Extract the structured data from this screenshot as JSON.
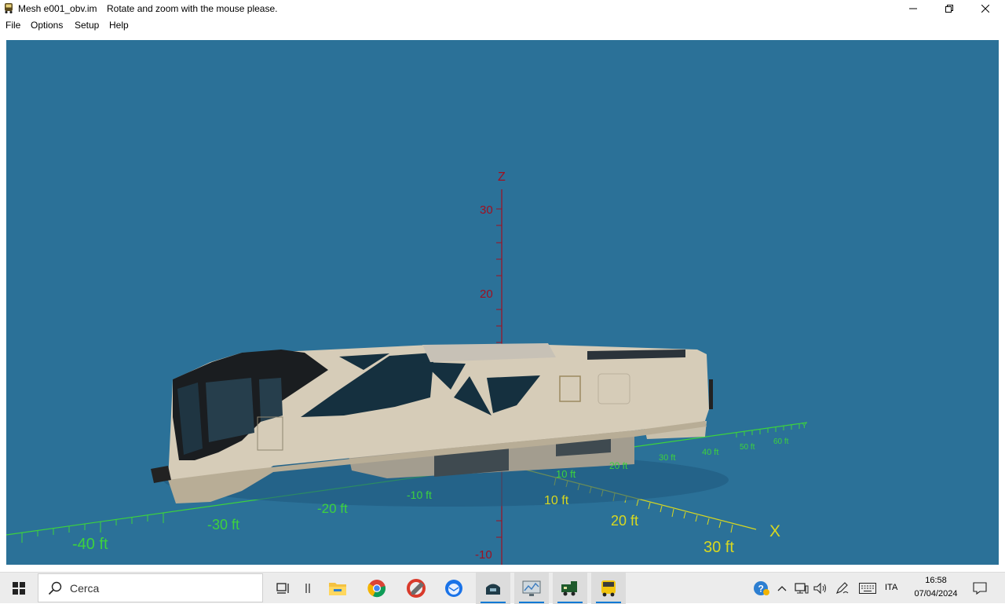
{
  "window": {
    "title": "Mesh e001_obv.im",
    "hint": "Rotate and zoom with the mouse please."
  },
  "menu": {
    "items": [
      "File",
      "Options",
      "Setup",
      "Help"
    ]
  },
  "viewport": {
    "background": "#2b7198",
    "z_axis": {
      "label": "Z",
      "color": "#a01020",
      "ticks": [
        "30",
        "20",
        "-10"
      ]
    },
    "x_axis": {
      "label": "X",
      "color": "#d8d820",
      "ticks": [
        "10 ft",
        "20 ft",
        "30 ft"
      ]
    },
    "y_axis": {
      "label": "Y",
      "color": "#3dd23d",
      "ticks_negative": [
        "-10 ft",
        "-20 ft",
        "-30 ft",
        "-40 ft"
      ],
      "ticks_positive": [
        "10 ft",
        "20 ft",
        "30 ft",
        "40 ft",
        "50 ft",
        "60 ft"
      ]
    },
    "model": {
      "name": "train car",
      "body_color": "#d6ccb8",
      "window_color": "#15303f"
    }
  },
  "taskbar": {
    "search_placeholder": "Cerca",
    "apps": [
      "task-view",
      "widgets",
      "file-explorer",
      "chrome",
      "ccleaner",
      "thunderbird",
      "app-train-dark",
      "app-monitor",
      "app-locomotive",
      "app-mesh-viewer"
    ],
    "tray": {
      "language": "ITA",
      "time": "16:58",
      "date": "07/04/2024"
    }
  }
}
